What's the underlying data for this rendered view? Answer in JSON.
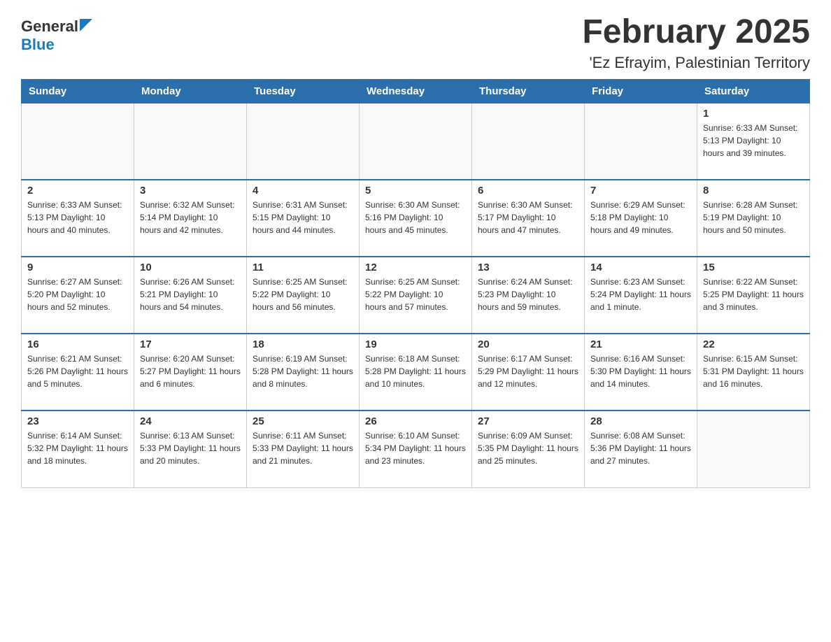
{
  "header": {
    "logo_general": "General",
    "logo_blue": "Blue",
    "title": "February 2025",
    "subtitle": "'Ez Efrayim, Palestinian Territory"
  },
  "weekdays": [
    "Sunday",
    "Monday",
    "Tuesday",
    "Wednesday",
    "Thursday",
    "Friday",
    "Saturday"
  ],
  "weeks": [
    [
      {
        "day": "",
        "info": ""
      },
      {
        "day": "",
        "info": ""
      },
      {
        "day": "",
        "info": ""
      },
      {
        "day": "",
        "info": ""
      },
      {
        "day": "",
        "info": ""
      },
      {
        "day": "",
        "info": ""
      },
      {
        "day": "1",
        "info": "Sunrise: 6:33 AM\nSunset: 5:13 PM\nDaylight: 10 hours and 39 minutes."
      }
    ],
    [
      {
        "day": "2",
        "info": "Sunrise: 6:33 AM\nSunset: 5:13 PM\nDaylight: 10 hours and 40 minutes."
      },
      {
        "day": "3",
        "info": "Sunrise: 6:32 AM\nSunset: 5:14 PM\nDaylight: 10 hours and 42 minutes."
      },
      {
        "day": "4",
        "info": "Sunrise: 6:31 AM\nSunset: 5:15 PM\nDaylight: 10 hours and 44 minutes."
      },
      {
        "day": "5",
        "info": "Sunrise: 6:30 AM\nSunset: 5:16 PM\nDaylight: 10 hours and 45 minutes."
      },
      {
        "day": "6",
        "info": "Sunrise: 6:30 AM\nSunset: 5:17 PM\nDaylight: 10 hours and 47 minutes."
      },
      {
        "day": "7",
        "info": "Sunrise: 6:29 AM\nSunset: 5:18 PM\nDaylight: 10 hours and 49 minutes."
      },
      {
        "day": "8",
        "info": "Sunrise: 6:28 AM\nSunset: 5:19 PM\nDaylight: 10 hours and 50 minutes."
      }
    ],
    [
      {
        "day": "9",
        "info": "Sunrise: 6:27 AM\nSunset: 5:20 PM\nDaylight: 10 hours and 52 minutes."
      },
      {
        "day": "10",
        "info": "Sunrise: 6:26 AM\nSunset: 5:21 PM\nDaylight: 10 hours and 54 minutes."
      },
      {
        "day": "11",
        "info": "Sunrise: 6:25 AM\nSunset: 5:22 PM\nDaylight: 10 hours and 56 minutes."
      },
      {
        "day": "12",
        "info": "Sunrise: 6:25 AM\nSunset: 5:22 PM\nDaylight: 10 hours and 57 minutes."
      },
      {
        "day": "13",
        "info": "Sunrise: 6:24 AM\nSunset: 5:23 PM\nDaylight: 10 hours and 59 minutes."
      },
      {
        "day": "14",
        "info": "Sunrise: 6:23 AM\nSunset: 5:24 PM\nDaylight: 11 hours and 1 minute."
      },
      {
        "day": "15",
        "info": "Sunrise: 6:22 AM\nSunset: 5:25 PM\nDaylight: 11 hours and 3 minutes."
      }
    ],
    [
      {
        "day": "16",
        "info": "Sunrise: 6:21 AM\nSunset: 5:26 PM\nDaylight: 11 hours and 5 minutes."
      },
      {
        "day": "17",
        "info": "Sunrise: 6:20 AM\nSunset: 5:27 PM\nDaylight: 11 hours and 6 minutes."
      },
      {
        "day": "18",
        "info": "Sunrise: 6:19 AM\nSunset: 5:28 PM\nDaylight: 11 hours and 8 minutes."
      },
      {
        "day": "19",
        "info": "Sunrise: 6:18 AM\nSunset: 5:28 PM\nDaylight: 11 hours and 10 minutes."
      },
      {
        "day": "20",
        "info": "Sunrise: 6:17 AM\nSunset: 5:29 PM\nDaylight: 11 hours and 12 minutes."
      },
      {
        "day": "21",
        "info": "Sunrise: 6:16 AM\nSunset: 5:30 PM\nDaylight: 11 hours and 14 minutes."
      },
      {
        "day": "22",
        "info": "Sunrise: 6:15 AM\nSunset: 5:31 PM\nDaylight: 11 hours and 16 minutes."
      }
    ],
    [
      {
        "day": "23",
        "info": "Sunrise: 6:14 AM\nSunset: 5:32 PM\nDaylight: 11 hours and 18 minutes."
      },
      {
        "day": "24",
        "info": "Sunrise: 6:13 AM\nSunset: 5:33 PM\nDaylight: 11 hours and 20 minutes."
      },
      {
        "day": "25",
        "info": "Sunrise: 6:11 AM\nSunset: 5:33 PM\nDaylight: 11 hours and 21 minutes."
      },
      {
        "day": "26",
        "info": "Sunrise: 6:10 AM\nSunset: 5:34 PM\nDaylight: 11 hours and 23 minutes."
      },
      {
        "day": "27",
        "info": "Sunrise: 6:09 AM\nSunset: 5:35 PM\nDaylight: 11 hours and 25 minutes."
      },
      {
        "day": "28",
        "info": "Sunrise: 6:08 AM\nSunset: 5:36 PM\nDaylight: 11 hours and 27 minutes."
      },
      {
        "day": "",
        "info": ""
      }
    ]
  ]
}
